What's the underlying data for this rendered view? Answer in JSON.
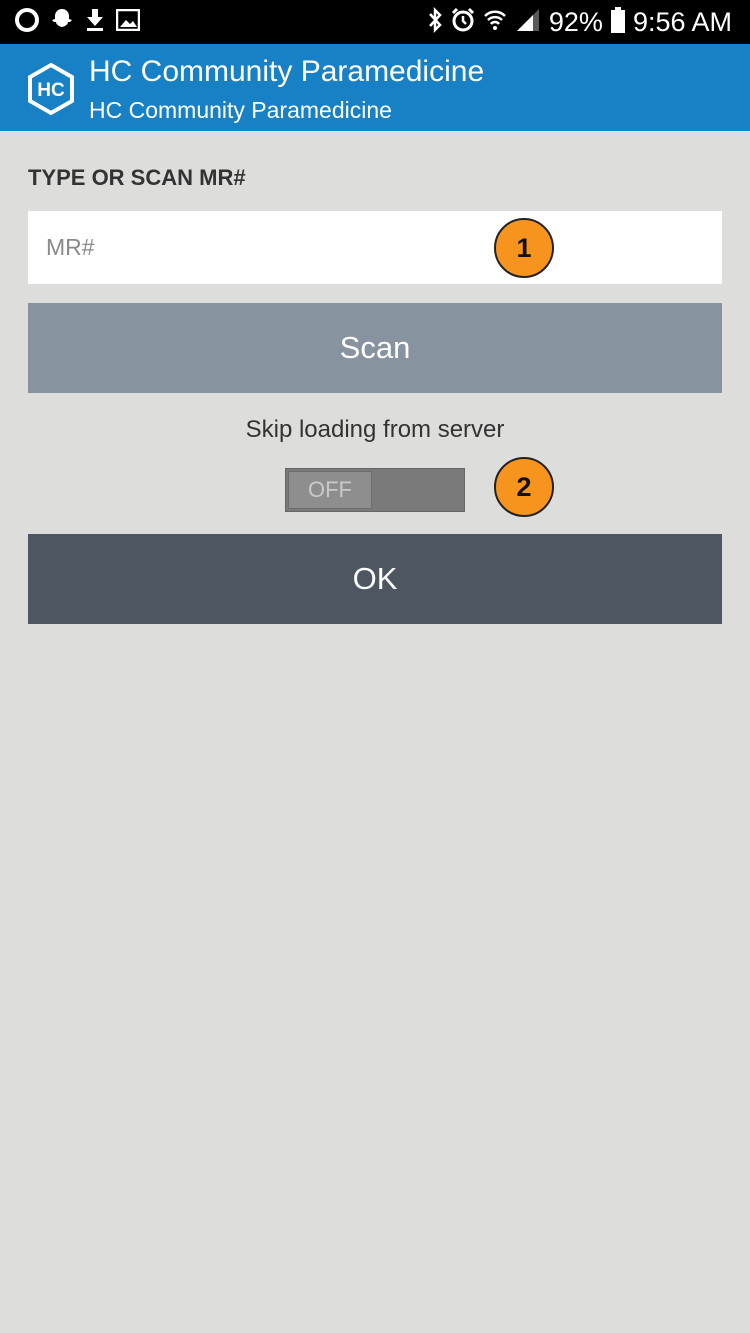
{
  "status_bar": {
    "battery_percent": "92%",
    "time": "9:56 AM",
    "left_icons": [
      "circle-notification-icon",
      "snapchat-icon",
      "download-icon",
      "gallery-icon"
    ],
    "right_icons": [
      "bluetooth-icon",
      "alarm-icon",
      "wifi-icon",
      "signal-icon",
      "battery-icon"
    ]
  },
  "app_bar": {
    "logo_text": "HC",
    "title": "HC Community Paramedicine",
    "subtitle": "HC Community Paramedicine",
    "color": "#1880c4"
  },
  "form": {
    "section_label": "TYPE OR SCAN MR#",
    "mr_input": {
      "placeholder": "MR#",
      "value": ""
    },
    "scan_button_label": "Scan",
    "skip_label": "Skip loading from server",
    "skip_toggle": {
      "state_label": "OFF",
      "on": false
    },
    "ok_button_label": "OK"
  },
  "callouts": [
    "1",
    "2"
  ],
  "colors": {
    "background": "#dddddb",
    "scan_button": "#8794a0",
    "ok_button": "#4e5661",
    "callout": "#f7941d"
  }
}
